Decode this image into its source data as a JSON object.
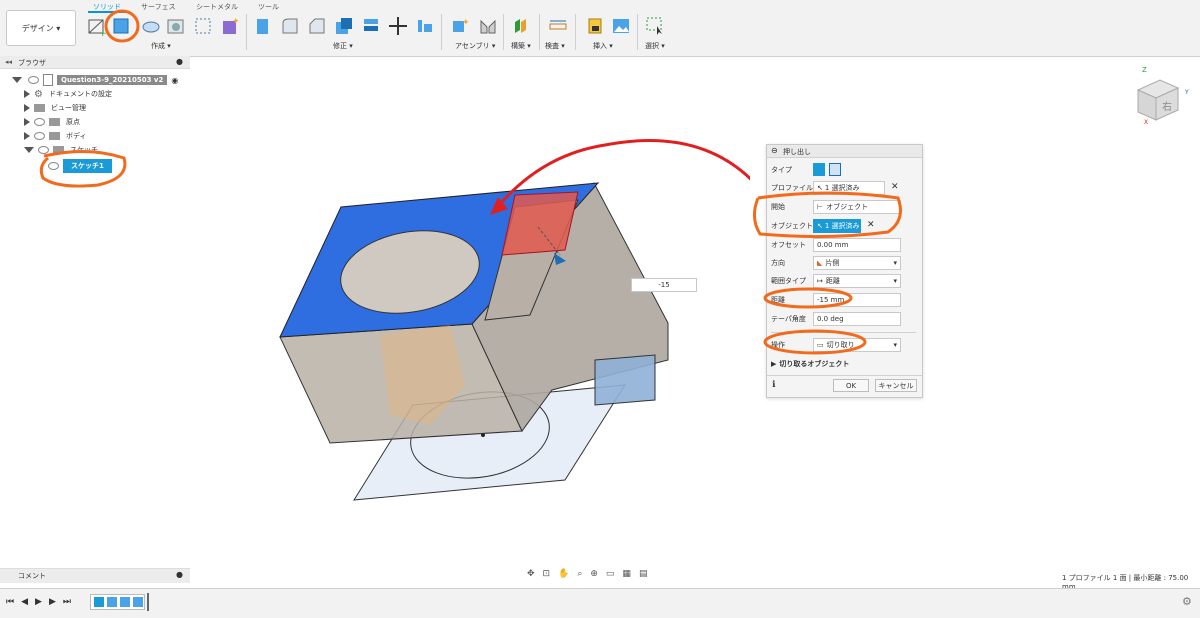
{
  "toolbar": {
    "workspace_label": "デザイン ▾",
    "tabs": [
      "ソリッド",
      "サーフェス",
      "シートメタル",
      "ツール"
    ],
    "groups": [
      "作成 ▾",
      "修正 ▾",
      "アセンブリ ▾",
      "構築 ▾",
      "検査 ▾",
      "挿入 ▾",
      "選択 ▾"
    ]
  },
  "browser": {
    "header": "ブラウザ",
    "root": "Question3-9_20210503 v2",
    "items": [
      "ドキュメントの設定",
      "ビュー管理",
      "原点",
      "ボディ",
      "スケッチ"
    ],
    "sketch_child": "スケッチ1"
  },
  "dimension": {
    "value": "-15"
  },
  "dialog": {
    "title": "押し出し",
    "rows": {
      "type_label": "タイプ",
      "profile_label": "プロファイル",
      "profile_value": "1 選択済み",
      "start_label": "開始",
      "start_value": "オブジェクト",
      "object_label": "オブジェクト",
      "object_value": "1 選択済み",
      "offset_label": "オフセット",
      "offset_value": "0.00 mm",
      "direction_label": "方向",
      "direction_value": "片側",
      "extent_label": "範囲タイプ",
      "extent_value": "距離",
      "distance_label": "距離",
      "distance_value": "-15 mm",
      "taper_label": "テーパ角度",
      "taper_value": "0.0 deg",
      "operation_label": "操作",
      "operation_value": "切り取り",
      "cut_objects_label": "切り取るオブジェクト"
    },
    "ok": "OK",
    "cancel": "キャンセル"
  },
  "viewcube": {
    "face_label": "右"
  },
  "comment_bar": "コメント",
  "status": "1 プロファイル 1 面 | 最小距離 : 75.00 mm",
  "colors": {
    "accent": "#0696d7",
    "annotation": "#f26a1b",
    "top_face": "#2f6ee0"
  }
}
